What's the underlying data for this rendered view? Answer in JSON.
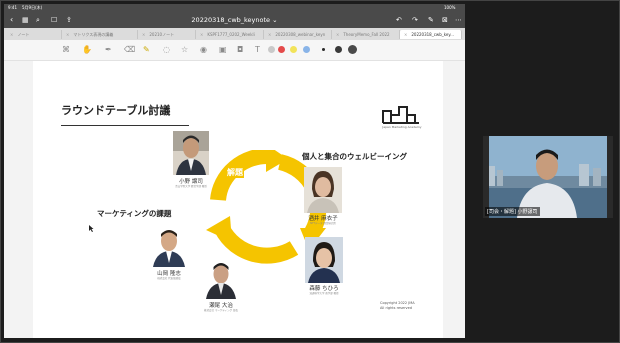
{
  "status_bar": {
    "time": "9:41",
    "date": "5月9日(木)",
    "battery": "100%"
  },
  "window": {
    "title": "20220318_cwb_keynote ⌄"
  },
  "tabs": [
    {
      "label": "ノート"
    },
    {
      "label": "マトリクス表現の講義"
    },
    {
      "label": "20210ノート"
    },
    {
      "label": "KSPF1777_0202_Weekli"
    },
    {
      "label": "20220308_webinar_keyn"
    },
    {
      "label": "TheoryMemo_Fall 2022"
    },
    {
      "label": "20220318_cwb_key..."
    }
  ],
  "toolbar": {
    "colors": [
      "#c9c9c9",
      "#e44a4a",
      "#f2e35a",
      "#89b4e8",
      "#2a2a2a",
      "#3a3a3a",
      "#4a4a4a"
    ]
  },
  "slide": {
    "title": "ラウンドテーブル討議",
    "logo_text": "Japan Marketing Academy",
    "cycle_labels": {
      "top": "解題",
      "left": "マーケティングの課題",
      "right": "個人と集合のウェルビーイング"
    },
    "people": [
      {
        "name": "小野 譲司",
        "role": "青山学院大学 経営学部 教授"
      },
      {
        "name": "酒井 麻衣子",
        "role": "NTTデータ 経営研究所"
      },
      {
        "name": "山岡 隆志",
        "role": "株式会社 代表取締役"
      },
      {
        "name": "森藤 ちひろ",
        "role": "流通科学大学 商学部 教授"
      },
      {
        "name": "瀬尾 大治",
        "role": "株式会社 マーケティング 部長"
      }
    ],
    "copyright_line1": "Copyright 2022 JMA",
    "copyright_line2": "All rights reserved"
  },
  "webcam": {
    "label": "[司会・解題] 小野譲司"
  }
}
